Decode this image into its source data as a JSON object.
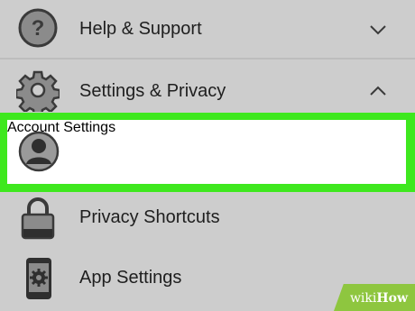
{
  "menu": {
    "help": {
      "label": "Help & Support",
      "icon": "question-icon",
      "state": "collapsed"
    },
    "settings_privacy": {
      "label": "Settings & Privacy",
      "icon": "gear-icon",
      "state": "expanded"
    },
    "items": [
      {
        "label": "Account Settings",
        "icon": "user-avatar-icon",
        "highlighted": true
      },
      {
        "label": "Privacy Shortcuts",
        "icon": "lock-icon"
      },
      {
        "label": "App Settings",
        "icon": "phone-gear-icon"
      }
    ]
  },
  "watermark": {
    "prefix": "wiki",
    "suffix": "How"
  },
  "colors": {
    "background": "#cdcdcd",
    "highlight_border": "#3ee81e",
    "highlight_fill": "#ffffff",
    "watermark_green": "#8ec63f"
  }
}
